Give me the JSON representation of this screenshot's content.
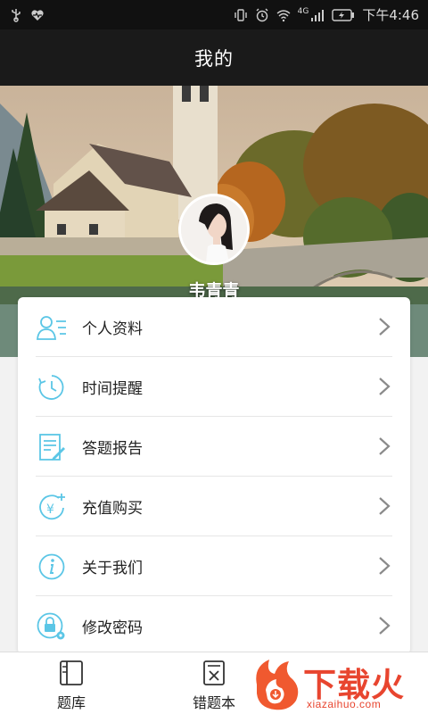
{
  "status_bar": {
    "time": "下午4:46",
    "network": "4G",
    "icons": [
      "usb-icon",
      "heart-rate-icon",
      "vibrate-icon",
      "alarm-icon",
      "wifi-icon",
      "signal-icon",
      "battery-charging-icon"
    ]
  },
  "header": {
    "title": "我的"
  },
  "profile": {
    "username": "韦青青",
    "level_badge": ""
  },
  "menu": {
    "items": [
      {
        "label": "个人资料",
        "icon": "profile-icon"
      },
      {
        "label": "时间提醒",
        "icon": "clock-reminder-icon"
      },
      {
        "label": "答题报告",
        "icon": "report-icon"
      },
      {
        "label": "充值购买",
        "icon": "recharge-icon"
      },
      {
        "label": "关于我们",
        "icon": "info-icon"
      },
      {
        "label": "修改密码",
        "icon": "lock-icon"
      }
    ]
  },
  "bottom_nav": {
    "items": [
      {
        "label": "题库",
        "icon": "question-bank-icon"
      },
      {
        "label": "错题本",
        "icon": "wrong-notebook-icon"
      }
    ]
  },
  "watermark": {
    "text": "下载火",
    "url": "xiazaihuo.com"
  },
  "colors": {
    "accent": "#5bc6e6",
    "badge_border": "#f08a24",
    "watermark": "#e8452f"
  }
}
